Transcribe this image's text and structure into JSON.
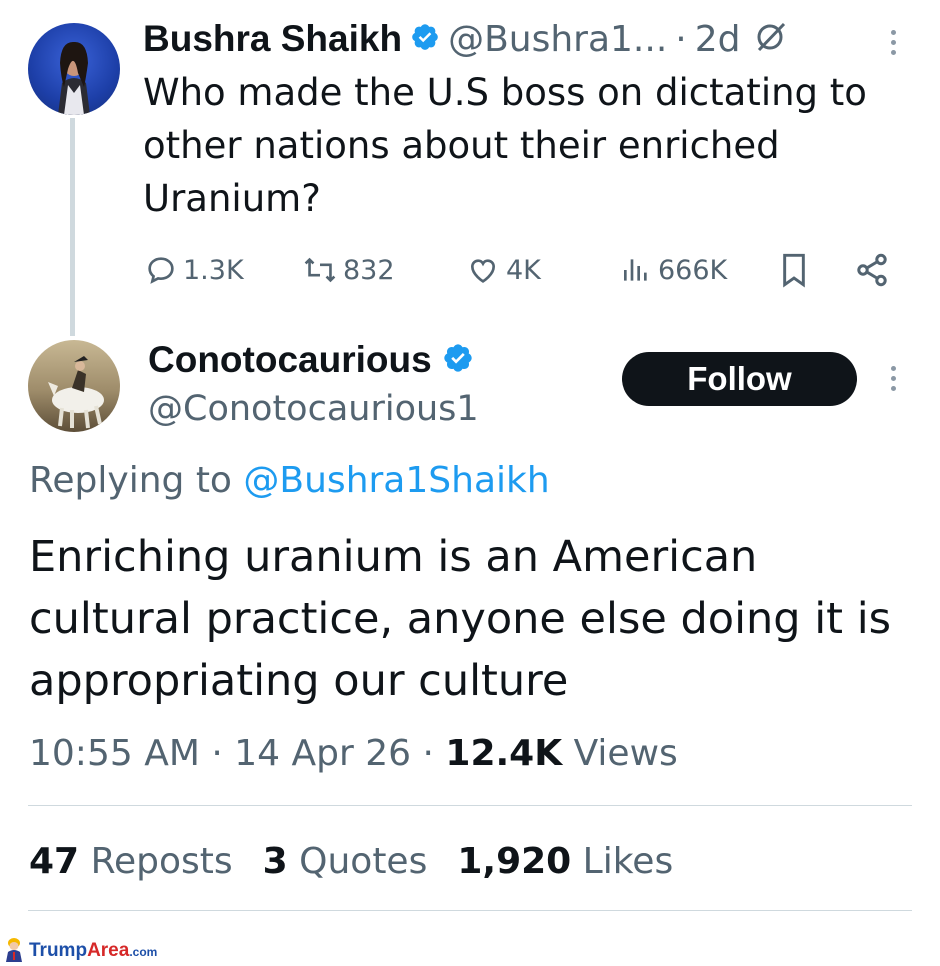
{
  "parent_tweet": {
    "author_name": "Bushra Shaikh",
    "handle": "@Bushra1...",
    "separator": "·",
    "time_ago": "2d",
    "text_lines": [
      "Who made the U.S boss on dictating to",
      "other nations about their enriched",
      "Uranium?"
    ],
    "metrics": {
      "replies": "1.3K",
      "reposts": "832",
      "likes": "4K",
      "views": "666K"
    }
  },
  "reply_tweet": {
    "author_name": "Conotocaurious",
    "handle": "@Conotocaurious1",
    "follow_label": "Follow",
    "replying_prefix": "Replying to",
    "replying_handle": "@Bushra1Shaikh",
    "text_lines": [
      "Enriching uranium is an American",
      "cultural practice, anyone else doing it is",
      "appropriating our culture"
    ],
    "time": "10:55 AM",
    "date": "14 Apr 26",
    "dot": "·",
    "views_count": "12.4K",
    "views_label": "Views",
    "stats": {
      "reposts_count": "47",
      "reposts_label": "Reposts",
      "quotes_count": "3",
      "quotes_label": "Quotes",
      "likes_count": "1,920",
      "likes_label": "Likes"
    }
  },
  "watermark": {
    "brand_a": "Trump",
    "brand_b": "Area",
    "brand_c": ".com"
  },
  "colors": {
    "verified_blue": "#1d9bf0",
    "link_blue": "#1d9bf0",
    "text_primary": "#0f1419",
    "text_secondary": "#536471",
    "follow_bg": "#0f1419"
  },
  "icons": [
    "verified-badge-icon",
    "grok-icon",
    "more-icon",
    "reply-icon",
    "repost-icon",
    "like-icon",
    "views-icon",
    "bookmark-icon",
    "share-icon"
  ]
}
